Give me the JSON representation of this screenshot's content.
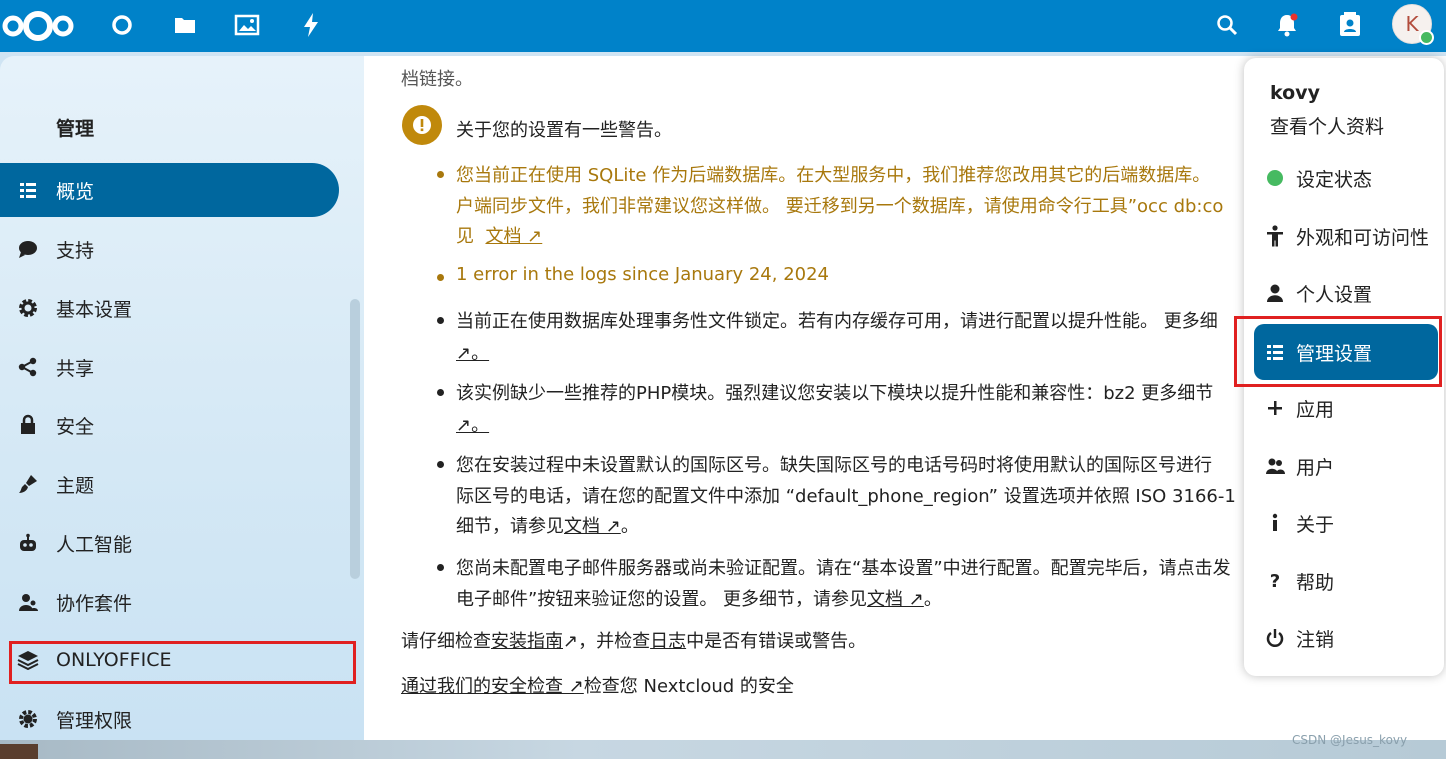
{
  "header": {
    "icons": [
      "nextcloud-logo",
      "dashboard-icon",
      "files-icon",
      "photos-icon",
      "activity-icon",
      "search-icon",
      "notifications-icon",
      "contacts-icon"
    ],
    "avatar_letter": "K",
    "accent": "#0082c9"
  },
  "sidebar": {
    "title": "管理",
    "items": [
      {
        "label": "概览",
        "icon": "list-icon",
        "active": true
      },
      {
        "label": "支持",
        "icon": "chat-bubble-icon"
      },
      {
        "label": "基本设置",
        "icon": "gear-icon"
      },
      {
        "label": "共享",
        "icon": "share-icon"
      },
      {
        "label": "安全",
        "icon": "lock-icon"
      },
      {
        "label": "主题",
        "icon": "paint-brush-icon"
      },
      {
        "label": "人工智能",
        "icon": "robot-icon"
      },
      {
        "label": "协作套件",
        "icon": "user-group-icon"
      },
      {
        "label": "ONLYOFFICE",
        "icon": "layers-icon"
      },
      {
        "label": "管理权限",
        "icon": "gear-shield-icon"
      }
    ]
  },
  "main": {
    "top_text": "档链接。",
    "warning_heading": "关于您的设置有一些警告。",
    "warnings": {
      "sqlite_line1": "您当前正在使用 SQLite 作为后端数据库。在大型服务中，我们推荐您改用其它的后端数据库。",
      "sqlite_line2": "户端同步文件，我们非常建议您这样做。 要迁移到另一个数据库，请使用命令行工具”occ db:co",
      "sqlite_line3_prefix": "见",
      "sqlite_link": "文档 ↗",
      "logs_error": "1 error in the logs since January 24, 2024"
    },
    "notices": {
      "locking_line1": "当前正在使用数据库处理事务性文件锁定。若有内存缓存可用，请进行配置以提升性能。 更多细",
      "locking_line2": "↗。",
      "php_line1": "该实例缺少一些推荐的PHP模块。强烈建议您安装以下模块以提升性能和兼容性：bz2 更多细节",
      "php_line2": "↗。",
      "phone_line1": "您在安装过程中未设置默认的国际区号。缺失国际区号的电话号码时将使用默认的国际区号进行",
      "phone_line2": "际区号的电话，请在您的配置文件中添加 “default_phone_region” 设置选项并依照 ISO 3166-1",
      "phone_line3_prefix": "细节，请参见",
      "phone_link": "文档 ↗",
      "phone_line3_suffix": "。",
      "mail_line1": "您尚未配置电子邮件服务器或尚未验证配置。请在“基本设置”中进行配置。配置完毕后，请点击发",
      "mail_line2_prefix": "电子邮件”按钮来验证您的设置。 更多细节，请参见",
      "mail_link": "文档 ↗",
      "mail_line2_suffix": "。"
    },
    "check_prefix": "请仔细检查",
    "install_guide_link": "安装指南",
    "check_mid": "↗，并检查",
    "log_link": "日志",
    "check_suffix": "中是否有错误或警告。",
    "security_link": "通过我们的安全检查 ↗",
    "security_suffix": "检查您 Nextcloud 的安全"
  },
  "menu": {
    "username": "kovy",
    "profile_link": "查看个人资料",
    "items": [
      {
        "label": "设定状态",
        "icon": "status-dot-icon"
      },
      {
        "label": "外观和可访问性",
        "icon": "accessibility-icon"
      },
      {
        "label": "个人设置",
        "icon": "user-icon"
      },
      {
        "label": "管理设置",
        "icon": "list-icon",
        "active": true
      },
      {
        "label": "应用",
        "icon": "plus-icon"
      },
      {
        "label": "用户",
        "icon": "users-icon"
      },
      {
        "label": "关于",
        "icon": "info-icon"
      },
      {
        "label": "帮助",
        "icon": "help-icon"
      },
      {
        "label": "注销",
        "icon": "power-icon"
      }
    ]
  },
  "watermark": "CSDN @Jesus_kovy"
}
